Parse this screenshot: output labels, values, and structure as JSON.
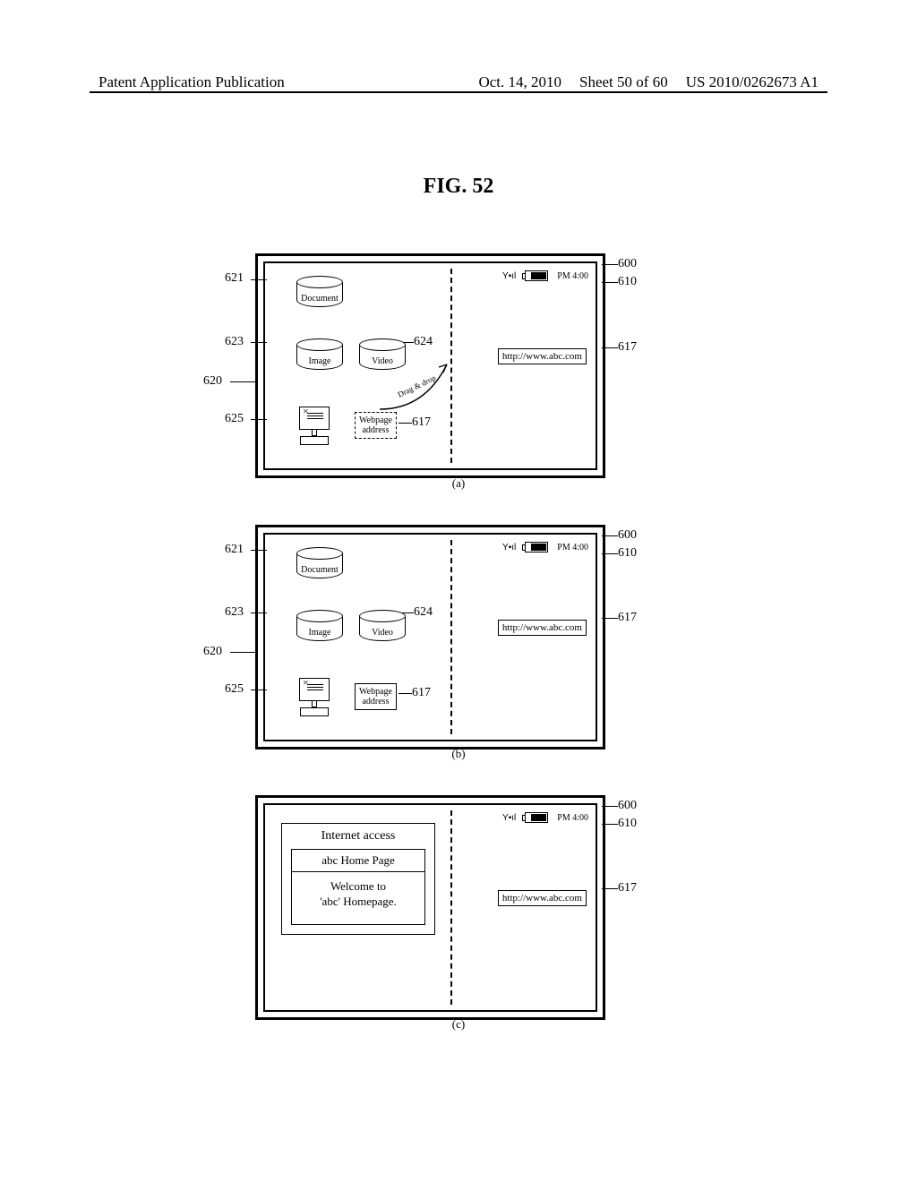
{
  "header": {
    "left": "Patent Application Publication",
    "date": "Oct. 14, 2010",
    "sheet": "Sheet 50 of 60",
    "pubno": "US 2010/0262673 A1"
  },
  "figure_title": "FIG. 52",
  "status": {
    "signal": "▮▮▯▯",
    "time": "PM 4:00"
  },
  "url": "http://www.abc.com",
  "drag_label": "Drag & drop",
  "cyl": {
    "document": "Document",
    "image": "Image",
    "video": "Video"
  },
  "webpage_addr": {
    "line1": "Webpage",
    "line2": "address"
  },
  "internet": {
    "title": "Internet access",
    "sub_title": "abc Home Page",
    "body1": "Welcome to",
    "body2": "'abc' Homepage."
  },
  "refnums": {
    "n600": "600",
    "n610": "610",
    "n617": "617",
    "n620": "620",
    "n621": "621",
    "n623": "623",
    "n624": "624",
    "n625": "625"
  },
  "panel_labels": {
    "a": "(a)",
    "b": "(b)",
    "c": "(c)"
  },
  "sigglyph": "Y▪ıl"
}
